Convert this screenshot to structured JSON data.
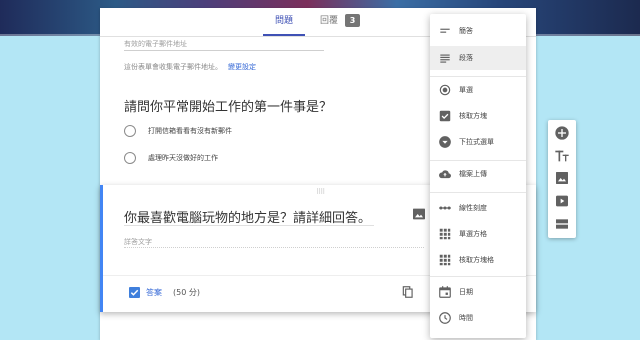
{
  "tabs": {
    "questions": "問題",
    "responses": "回覆",
    "responses_count": "3"
  },
  "email": {
    "placeholder": "有效的電子郵件地址",
    "note": "這份表單會收集電子郵件地址。",
    "settings_link": "變更設定"
  },
  "question1": {
    "title": "請問你平常開始工作的第一件事是？",
    "options": [
      "打開信箱看看有沒有新郵件",
      "處理昨天沒做好的工作"
    ]
  },
  "question2": {
    "title": "你最喜歡電腦玩物的地方是？請詳細回答。",
    "answer_hint": "詳答文字",
    "answer_key_label": "答案",
    "points": "(50 分)"
  },
  "type_menu": {
    "items": [
      "簡答",
      "段落",
      "單選",
      "核取方塊",
      "下拉式選單",
      "檔案上傳",
      "線性刻度",
      "單選方格",
      "核取方塊格",
      "日期",
      "時間"
    ],
    "selected": "段落"
  },
  "colors": {
    "accent": "#3f51b5",
    "link": "#3367d6",
    "background": "#b3e6f5",
    "active_border": "#4285f4"
  },
  "side_toolbar": [
    "add-question-icon",
    "add-title-icon",
    "add-image-icon",
    "add-video-icon",
    "add-section-icon"
  ]
}
